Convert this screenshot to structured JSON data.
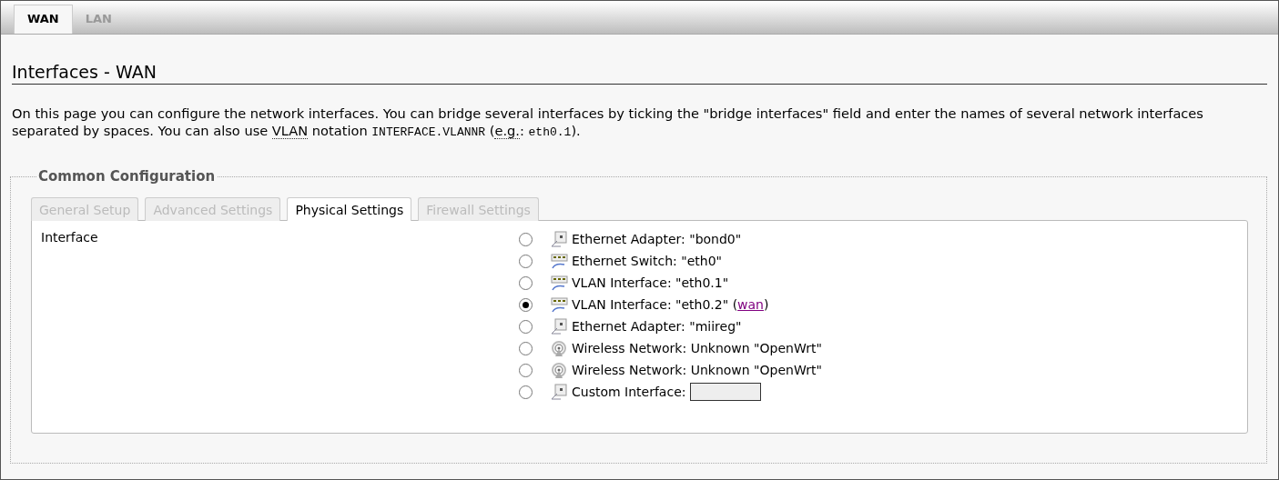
{
  "top_tabs": [
    {
      "label": "WAN",
      "selected": true
    },
    {
      "label": "LAN",
      "selected": false
    }
  ],
  "heading": "Interfaces - WAN",
  "description": [
    {
      "kind": "text",
      "text": "On this page you can configure the network interfaces. You can bridge several interfaces by ticking the \"bridge interfaces\" field and enter the names of several network interfaces separated by spaces. You can also use "
    },
    {
      "kind": "abbr",
      "text": "VLAN"
    },
    {
      "kind": "text",
      "text": " notation "
    },
    {
      "kind": "code",
      "text": "INTERFACE.VLANNR"
    },
    {
      "kind": "text",
      "text": " ("
    },
    {
      "kind": "abbr",
      "text": "e.g."
    },
    {
      "kind": "text",
      "text": ": "
    },
    {
      "kind": "code",
      "text": "eth0.1"
    },
    {
      "kind": "text",
      "text": ")."
    }
  ],
  "section": {
    "legend": "Common Configuration",
    "tabs": [
      {
        "label": "General Setup",
        "selected": false
      },
      {
        "label": "Advanced Settings",
        "selected": false
      },
      {
        "label": "Physical Settings",
        "selected": true
      },
      {
        "label": "Firewall Settings",
        "selected": false
      }
    ],
    "field_label": "Interface",
    "options": [
      {
        "kind": "adapter",
        "label": "Ethernet Adapter: \"bond0\"",
        "selected": false
      },
      {
        "kind": "switch",
        "label": "Ethernet Switch: \"eth0\"",
        "selected": false
      },
      {
        "kind": "switch",
        "label": "VLAN Interface: \"eth0.1\"",
        "selected": false
      },
      {
        "kind": "switch",
        "label": "VLAN Interface: \"eth0.2\"",
        "network_open": "(",
        "network": "wan",
        "network_close": ")",
        "selected": true
      },
      {
        "kind": "adapter",
        "label": "Ethernet Adapter: \"miireg\"",
        "selected": false
      },
      {
        "kind": "wireless",
        "label": "Wireless Network: Unknown \"OpenWrt\"",
        "selected": false
      },
      {
        "kind": "wireless",
        "label": "Wireless Network: Unknown \"OpenWrt\"",
        "selected": false
      },
      {
        "kind": "custom",
        "label": "Custom Interface:",
        "selected": false
      }
    ]
  }
}
